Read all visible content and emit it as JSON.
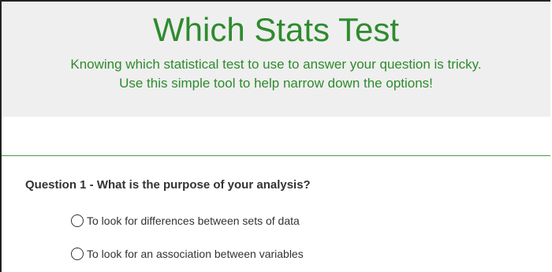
{
  "header": {
    "title": "Which Stats Test",
    "subtitle_line1": "Knowing which statistical test to use to answer your question is tricky.",
    "subtitle_line2": "Use this simple tool to help narrow down the options!"
  },
  "question1": {
    "label": "Question 1 - What is the purpose of your analysis?",
    "options": [
      {
        "label": "To look for differences between sets of data",
        "selected": false
      },
      {
        "label": "To look for an association between variables",
        "selected": false
      }
    ]
  },
  "colors": {
    "accent": "#2e8b2e",
    "header_bg": "#efefef",
    "text": "#333333"
  }
}
